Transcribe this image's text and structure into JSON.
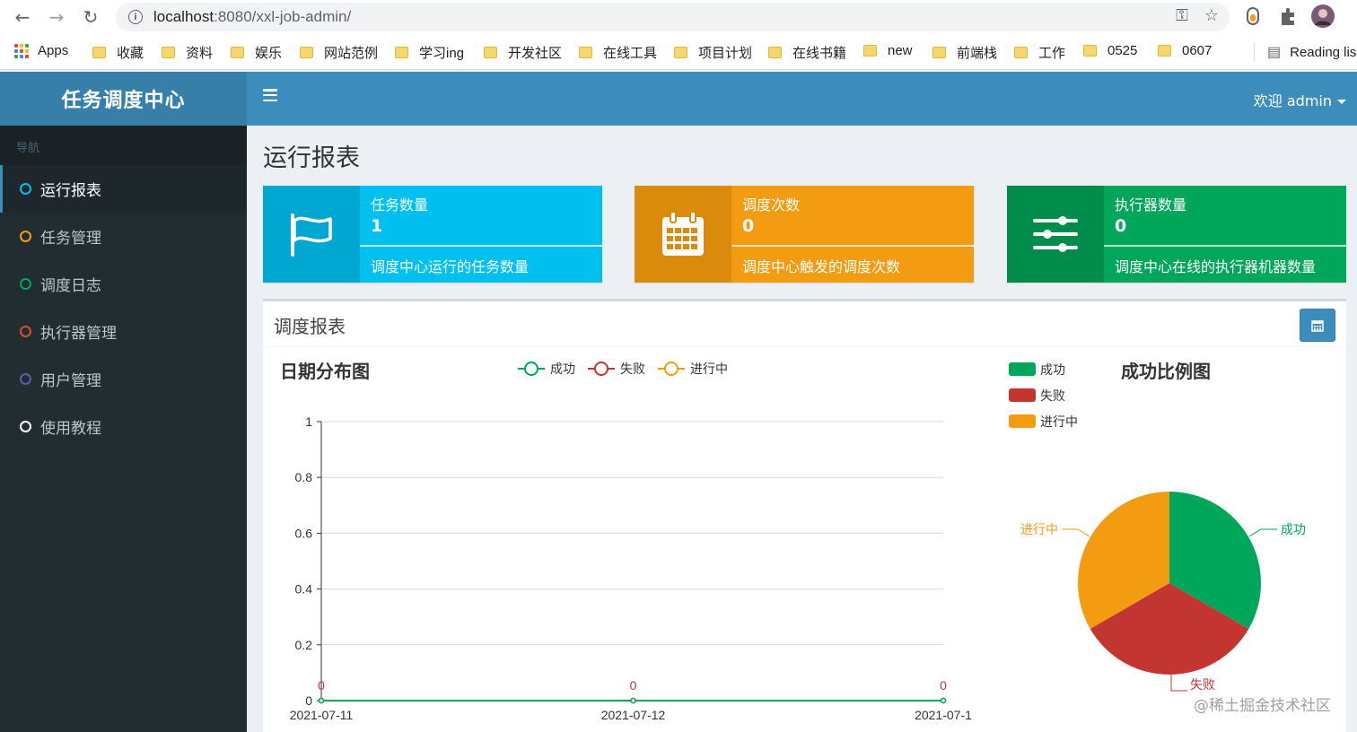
{
  "browser": {
    "url_host": "localhost",
    "url_path": ":8080/xxl-job-admin/",
    "bookmarks": [
      "收藏",
      "资料",
      "娱乐",
      "网站范例",
      "学习ing",
      "开发社区",
      "在线工具",
      "项目计划",
      "在线书籍",
      "new",
      "前端栈",
      "工作",
      "0525",
      "0607"
    ],
    "apps_label": "Apps",
    "reading_list": "Reading lis"
  },
  "header": {
    "logo": "任务调度中心",
    "user": "欢迎 admin"
  },
  "sidebar": {
    "header": "导航",
    "items": [
      {
        "label": "运行报表",
        "color": "#00c0ef"
      },
      {
        "label": "任务管理",
        "color": "#f39c12"
      },
      {
        "label": "调度日志",
        "color": "#00a65a"
      },
      {
        "label": "执行器管理",
        "color": "#dd4b39"
      },
      {
        "label": "用户管理",
        "color": "#605ca8"
      },
      {
        "label": "使用教程",
        "color": "#ffffff"
      }
    ]
  },
  "page": {
    "title": "运行报表"
  },
  "cards": [
    {
      "label": "任务数量",
      "value": "1",
      "desc": "调度中心运行的任务数量",
      "icon": "flag-icon",
      "color_icon": "#00a7d0",
      "color_body": "#00c0ef"
    },
    {
      "label": "调度次数",
      "value": "0",
      "desc": "调度中心触发的调度次数",
      "icon": "calendar-icon",
      "color_icon": "#db8b0b",
      "color_body": "#f39c12"
    },
    {
      "label": "执行器数量",
      "value": "0",
      "desc": "调度中心在线的执行器机器数量",
      "icon": "sliders-icon",
      "color_icon": "#008d4c",
      "color_body": "#00a65a"
    }
  ],
  "report": {
    "title": "调度报表"
  },
  "chart_data": [
    {
      "type": "line",
      "title": "日期分布图",
      "x": [
        "2021-07-11",
        "2021-07-12",
        "2021-07-1"
      ],
      "series": [
        {
          "name": "成功",
          "values": [
            0,
            0,
            0
          ],
          "color": "#00a65a"
        },
        {
          "name": "失败",
          "values": [
            0,
            0,
            0
          ],
          "color": "#c23531"
        },
        {
          "name": "进行中",
          "values": [
            0,
            0,
            0
          ],
          "color": "#f39c12"
        }
      ],
      "data_labels": [
        "0",
        "0",
        "0"
      ],
      "yticks": [
        "0",
        "0.2",
        "0.4",
        "0.6",
        "0.8",
        "1"
      ],
      "ylim": [
        0,
        1
      ],
      "grid": true,
      "legend": "top"
    },
    {
      "type": "pie",
      "title": "成功比例图",
      "slices": [
        {
          "name": "成功",
          "value": 1,
          "color": "#00a65a"
        },
        {
          "name": "失败",
          "value": 1,
          "color": "#c23531"
        },
        {
          "name": "进行中",
          "value": 1,
          "color": "#f39c12"
        }
      ],
      "legend": "top-left"
    }
  ],
  "watermark": "@稀土掘金技术社区"
}
